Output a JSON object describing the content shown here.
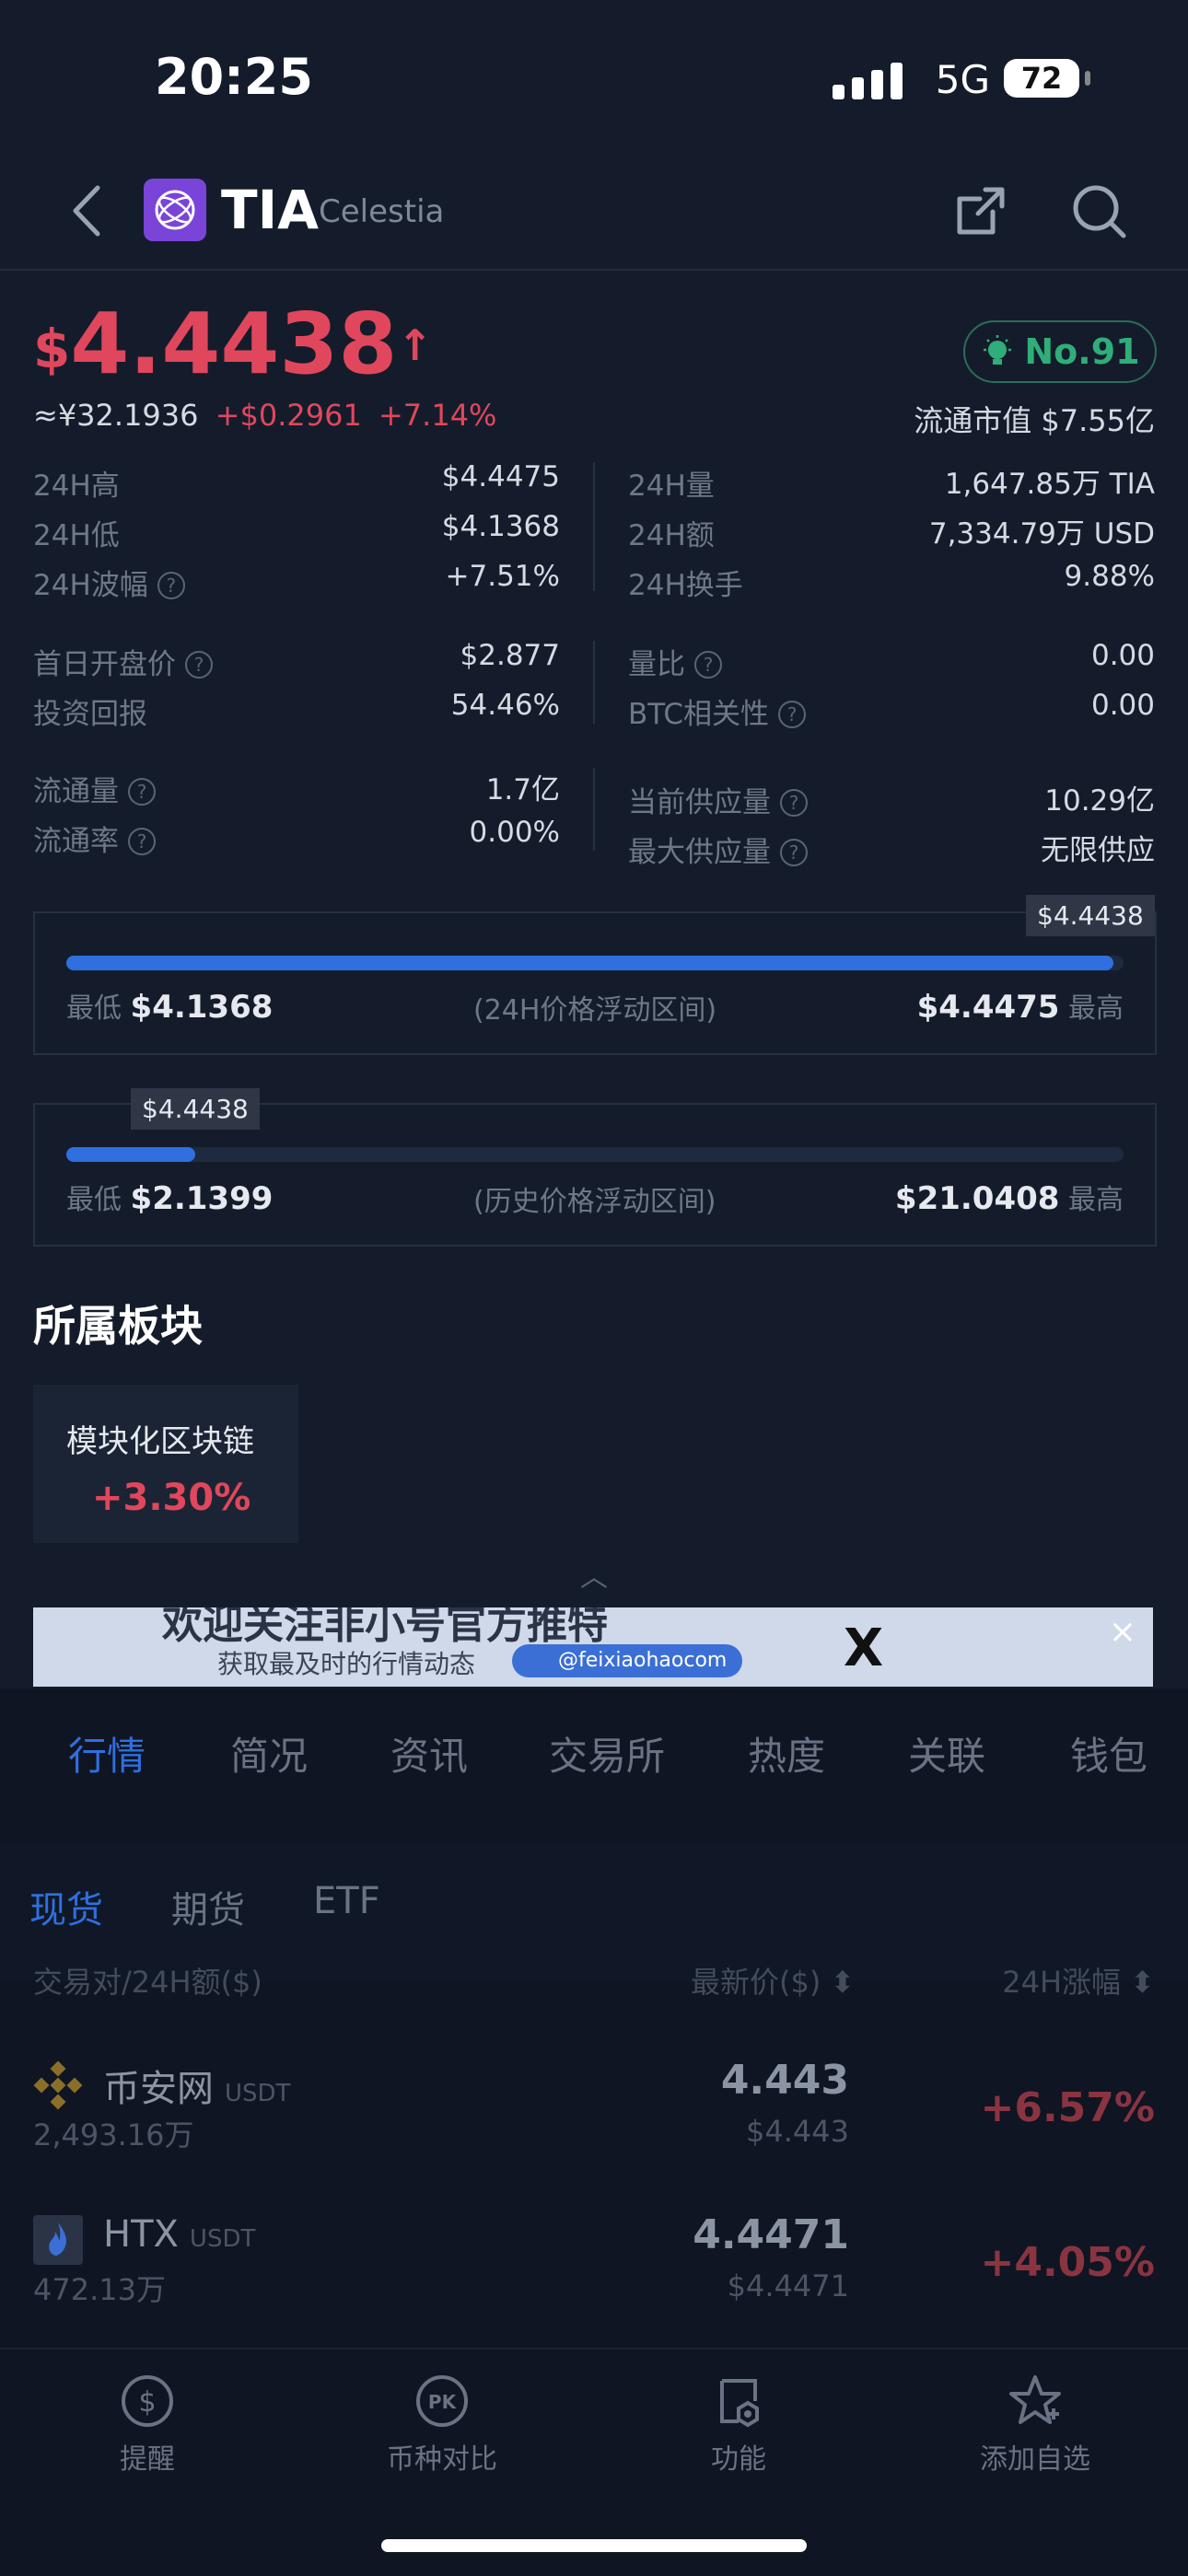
{
  "status_bar": {
    "time": "20:25",
    "network": "5G",
    "battery": "72"
  },
  "header": {
    "symbol": "TIA",
    "name": "Celestia"
  },
  "price": {
    "currency": "$",
    "value": "4.4438",
    "arrow": "↑",
    "cny": "≈¥32.1936",
    "change_abs": "+$0.2961",
    "change_pct": "+7.14%",
    "rank": "No.91",
    "market_cap": "流通市值 $7.55亿"
  },
  "stats_left": [
    {
      "k": "24H高",
      "v": "$4.4475"
    },
    {
      "k": "24H低",
      "v": "$4.1368"
    },
    {
      "k": "24H波幅",
      "v": "+7.51%"
    },
    {
      "k": "首日开盘价",
      "v": "$2.877"
    },
    {
      "k": "投资回报",
      "v": "54.46%"
    },
    {
      "k": "流通量",
      "v": "1.7亿"
    },
    {
      "k": "流通率",
      "v": "0.00%"
    }
  ],
  "stats_right": [
    {
      "k": "24H量",
      "v": "1,647.85万 TIA"
    },
    {
      "k": "24H额",
      "v": "7,334.79万 USD"
    },
    {
      "k": "24H换手",
      "v": "9.88%"
    },
    {
      "k": "量比",
      "v": "0.00"
    },
    {
      "k": "BTC相关性",
      "v": "0.00"
    },
    {
      "k": "当前供应量",
      "v": "10.29亿"
    },
    {
      "k": "最大供应量",
      "v": "无限供应"
    }
  ],
  "range_24h": {
    "current": "$4.4438",
    "low_label": "最低",
    "low": "$4.1368",
    "title": "(24H价格浮动区间)",
    "high": "$4.4475",
    "high_label": "最高",
    "fill_fraction": 0.99
  },
  "range_hist": {
    "current": "$4.4438",
    "low_label": "最低",
    "low": "$2.1399",
    "title": "(历史价格浮动区间)",
    "high": "$21.0408",
    "high_label": "最高",
    "fill_fraction": 0.122
  },
  "sector": {
    "title": "所属板块",
    "name": "模块化区块链",
    "pct": "+3.30%"
  },
  "banner": {
    "line1": "欢迎关注非小号官方推特",
    "line2": "获取最及时的行情动态",
    "handle": "@feixiaohaocom",
    "x_logo": "X",
    "close": "×"
  },
  "tabs": [
    "行情",
    "简况",
    "资讯",
    "交易所",
    "热度",
    "关联",
    "钱包"
  ],
  "subtabs": [
    "现货",
    "期货",
    "ETF"
  ],
  "columns": {
    "pair": "交易对/24H额($)",
    "price": "最新价($) ⬍",
    "change": "24H涨幅 ⬍"
  },
  "exchanges": [
    {
      "name": "币安网",
      "quote": "USDT",
      "volume": "2,493.16万",
      "price": "4.443",
      "usd": "$4.443",
      "change": "+6.57%"
    },
    {
      "name": "HTX",
      "quote": "USDT",
      "volume": "472.13万",
      "price": "4.4471",
      "usd": "$4.4471",
      "change": "+4.05%"
    }
  ],
  "bottom_nav": [
    "提醒",
    "币种对比",
    "功能",
    "添加自选"
  ],
  "colors": {
    "accent": "#2f6fe0",
    "up": "#e0475c",
    "rank": "#2fae79",
    "bg": "#141c2b"
  }
}
